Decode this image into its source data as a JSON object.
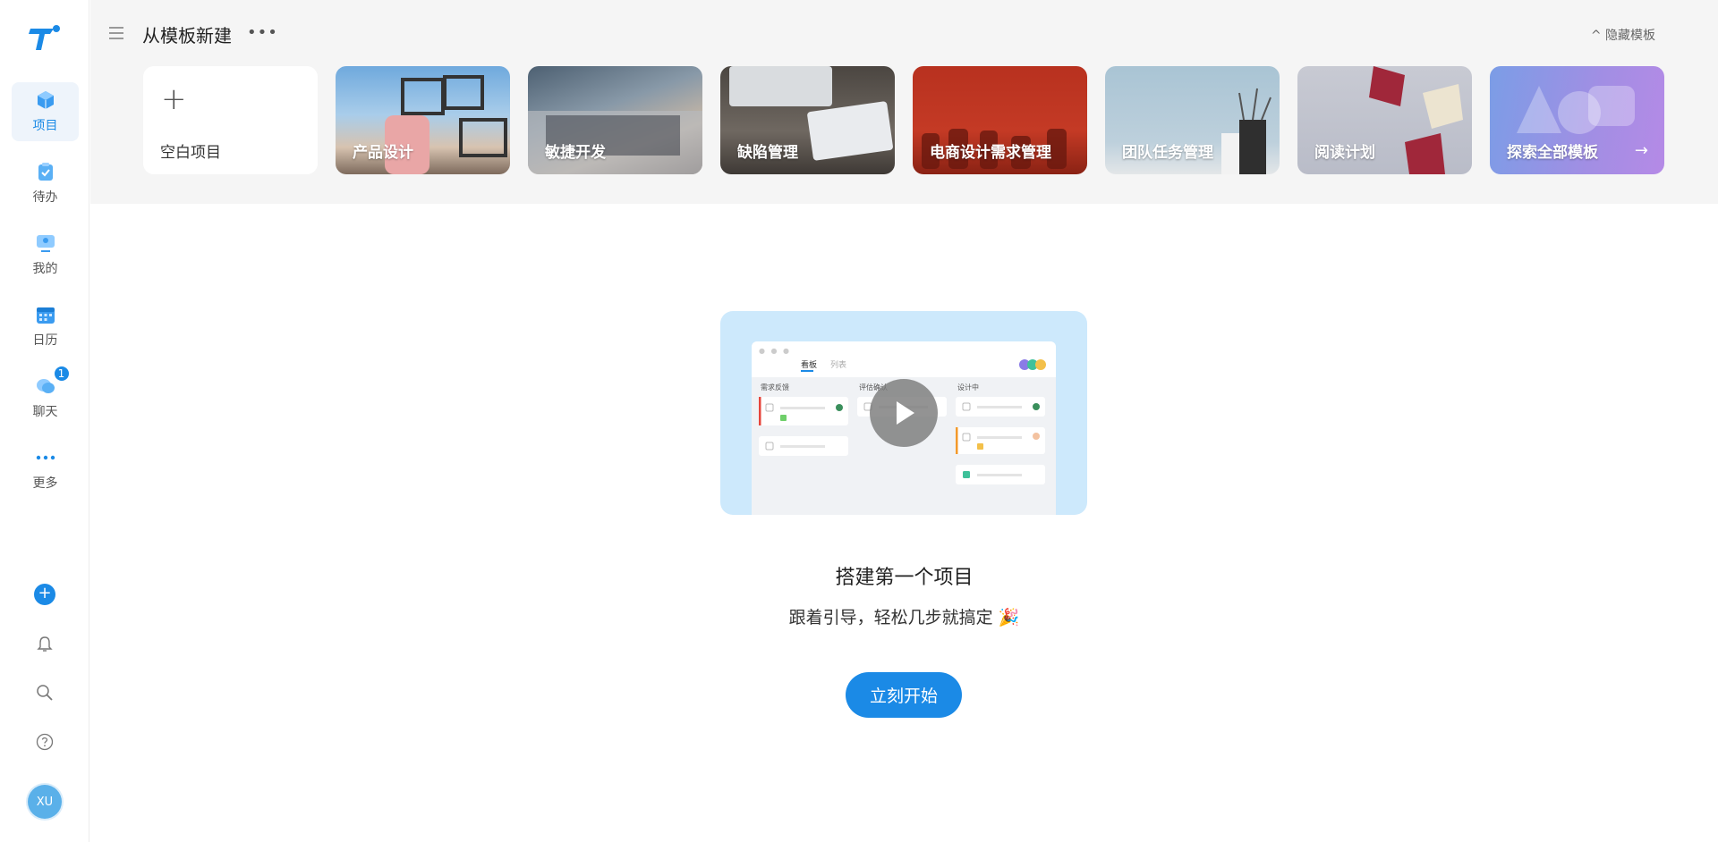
{
  "sidebar": {
    "items": [
      {
        "label": "项目",
        "icon": "project-cube-icon"
      },
      {
        "label": "待办",
        "icon": "clipboard-todo-icon"
      },
      {
        "label": "我的",
        "icon": "monitor-user-icon"
      },
      {
        "label": "日历",
        "icon": "calendar-icon"
      },
      {
        "label": "聊天",
        "icon": "chat-bubble-icon",
        "badge": "1"
      },
      {
        "label": "更多",
        "icon": "more-dots-icon"
      }
    ],
    "avatar_text": "XU"
  },
  "header": {
    "title": "从模板新建",
    "more": "•••",
    "hide_templates": "^ 隐藏模板"
  },
  "templates": {
    "blank_plus": "+",
    "blank_label": "空白项目",
    "cards": [
      {
        "label": "产品设计"
      },
      {
        "label": "敏捷开发"
      },
      {
        "label": "缺陷管理"
      },
      {
        "label": "电商设计需求管理"
      },
      {
        "label": "团队任务管理"
      },
      {
        "label": "阅读计划"
      },
      {
        "label": "探索全部模板"
      }
    ],
    "explore_arrow": "→"
  },
  "preview": {
    "tabs": [
      "看板",
      "列表"
    ],
    "columns": [
      "需求反馈",
      "评估确认",
      "设计中"
    ]
  },
  "empty_state": {
    "title": "搭建第一个项目",
    "subtitle": "跟着引导，轻松几步就搞定 🎉",
    "button": "立刻开始"
  },
  "colors": {
    "accent": "#1b8ae6",
    "header_bg": "#f5f5f5",
    "hero_bg": "#cde9fc"
  }
}
